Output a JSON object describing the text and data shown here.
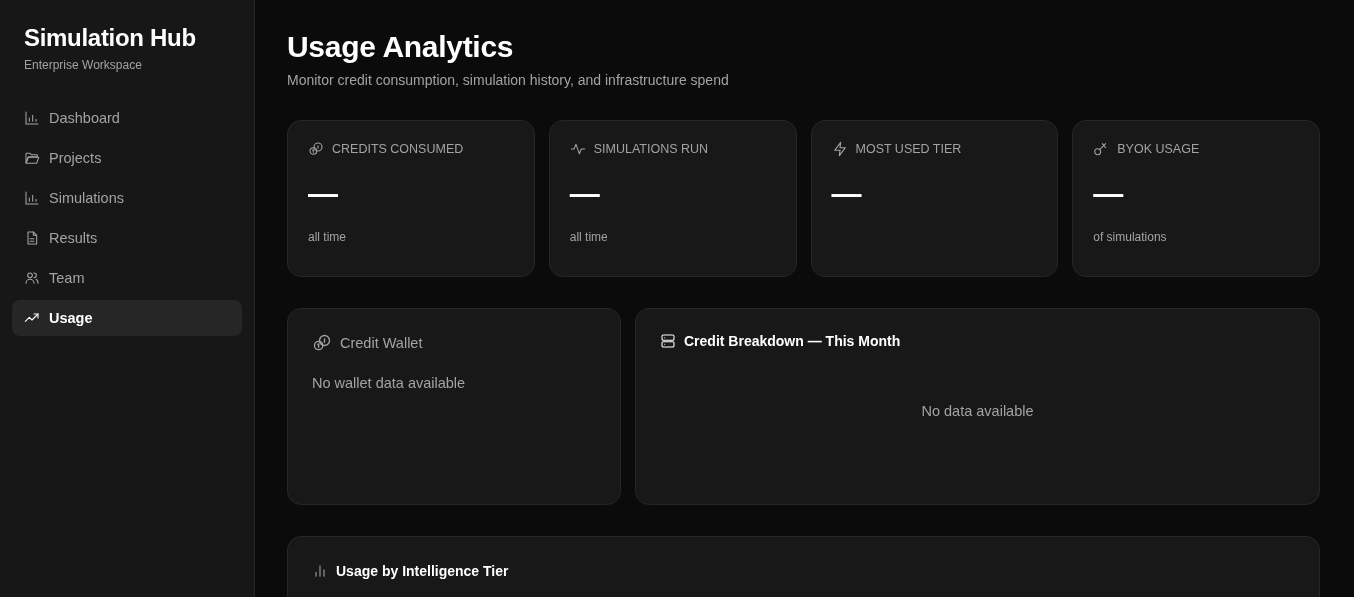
{
  "sidebar": {
    "title": "Simulation Hub",
    "subtitle": "Enterprise Workspace",
    "items": [
      {
        "label": "Dashboard",
        "selected": false
      },
      {
        "label": "Projects",
        "selected": false
      },
      {
        "label": "Simulations",
        "selected": false
      },
      {
        "label": "Results",
        "selected": false
      },
      {
        "label": "Team",
        "selected": false
      },
      {
        "label": "Usage",
        "selected": true
      }
    ]
  },
  "page": {
    "title": "Usage Analytics",
    "subtitle": "Monitor credit consumption, simulation history, and infrastructure spend"
  },
  "stats": [
    {
      "label": "CREDITS CONSUMED",
      "value": "—",
      "note": "all time"
    },
    {
      "label": "SIMULATIONS RUN",
      "value": "—",
      "note": "all time"
    },
    {
      "label": "MOST USED TIER",
      "value": "—"
    },
    {
      "label": "BYOK USAGE",
      "value": "—",
      "note": "of simulations"
    }
  ],
  "panels": [
    {
      "kind": "wallet",
      "title": "Credit Wallet",
      "empty": "No wallet data available"
    },
    {
      "kind": "chart",
      "title": "Credit Breakdown — This Month",
      "empty": "No data available"
    }
  ],
  "tier_panel": {
    "title": "Usage by Intelligence Tier"
  }
}
